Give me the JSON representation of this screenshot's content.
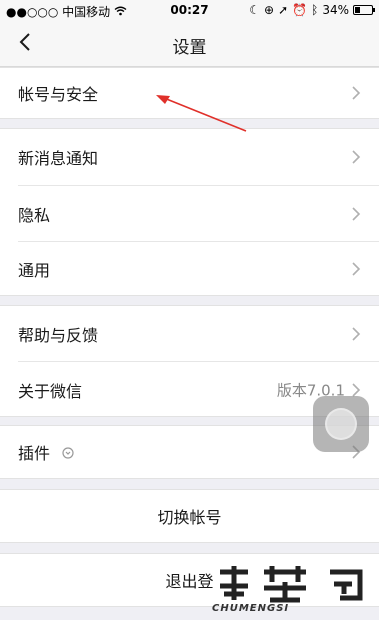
{
  "status_bar": {
    "carrier": "●●○○○ 中国移动",
    "time": "00:27",
    "battery": "34%",
    "battery_level": 0.34
  },
  "nav": {
    "title": "设置"
  },
  "settings": {
    "account_security": "帐号与安全",
    "new_message": "新消息通知",
    "privacy": "隐私",
    "general": "通用",
    "help_feedback": "帮助与反馈",
    "about": "关于微信",
    "about_version": "版本7.0.1",
    "plugins": "插件",
    "switch_account": "切换帐号",
    "logout": "退出登"
  },
  "watermark": {
    "brand": "CHUMENGSI",
    "logo_text": "楚梦司"
  },
  "colors": {
    "background": "#efeff4",
    "annotation_arrow": "#e0302a"
  },
  "icons": {
    "back": "chevron-left-icon",
    "disclosure": "chevron-right-icon",
    "plugin": "plugin-icon"
  }
}
